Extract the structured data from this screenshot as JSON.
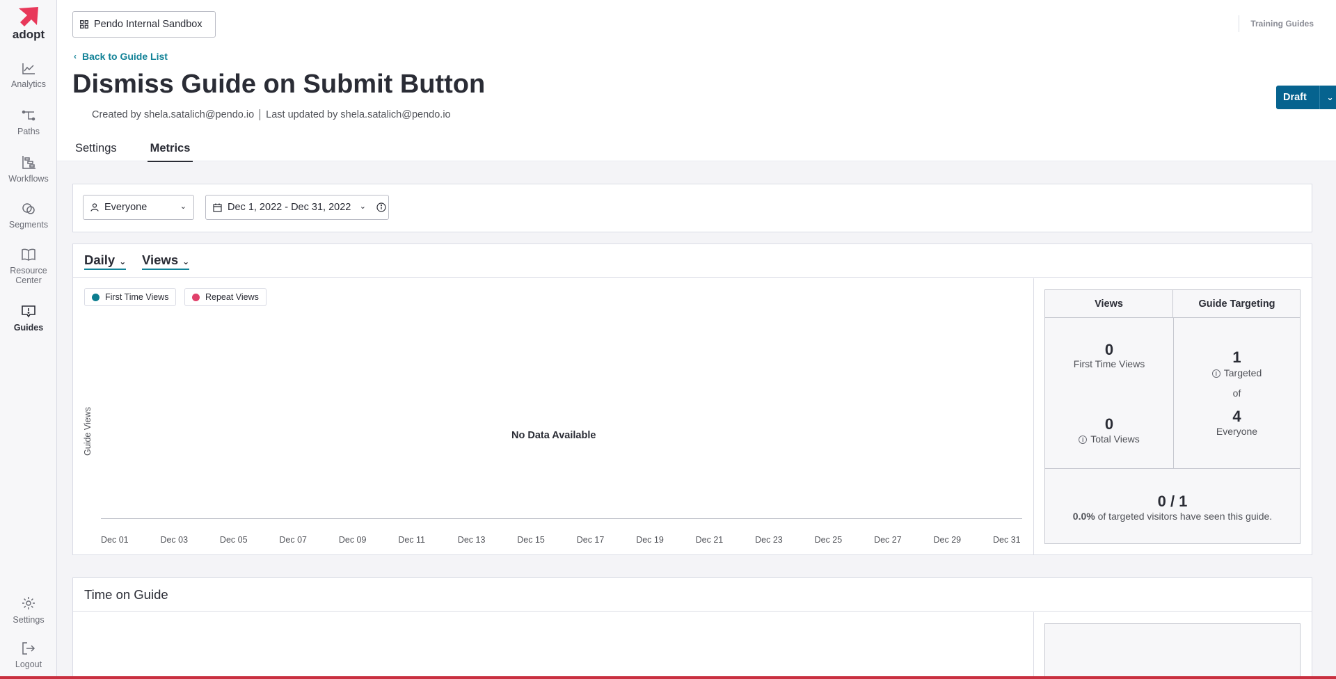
{
  "brand": {
    "name": "adopt",
    "accent": "#e8385a",
    "primary": "#06638f",
    "link": "#128297"
  },
  "sidebar": {
    "items": [
      {
        "label": "Analytics",
        "icon": "chart-line-icon"
      },
      {
        "label": "Paths",
        "icon": "paths-icon"
      },
      {
        "label": "Workflows",
        "icon": "workflows-icon"
      },
      {
        "label": "Segments",
        "icon": "segments-icon"
      },
      {
        "label": "Resource Center",
        "icon": "book-icon"
      },
      {
        "label": "Guides",
        "icon": "guides-icon"
      }
    ],
    "bottom": [
      {
        "label": "Settings",
        "icon": "gear-icon"
      },
      {
        "label": "Logout",
        "icon": "logout-icon"
      }
    ]
  },
  "header": {
    "app_selector": "Pendo Internal Sandbox",
    "training_guides": "Training Guides",
    "back_link": "Back to Guide List",
    "title": "Dismiss Guide on Submit Button",
    "created_by": "Created by shela.satalich@pendo.io",
    "updated_by": "Last updated by shela.satalich@pendo.io",
    "status_button": "Draft",
    "more": "···"
  },
  "tabs": [
    {
      "label": "Settings",
      "active": false
    },
    {
      "label": "Metrics",
      "active": true
    }
  ],
  "filters": {
    "segment": "Everyone",
    "date_range": "Dec 1, 2022 - Dec 31, 2022"
  },
  "chart": {
    "interval": "Daily",
    "metric": "Views",
    "legend": [
      {
        "name": "First Time Views",
        "color": "#0c7d8f"
      },
      {
        "name": "Repeat Views",
        "color": "#e0406a"
      }
    ],
    "ylabel": "Guide Views",
    "empty_message": "No Data Available",
    "ticks": [
      "Dec 01",
      "Dec 03",
      "Dec 05",
      "Dec 07",
      "Dec 09",
      "Dec 11",
      "Dec 13",
      "Dec 15",
      "Dec 17",
      "Dec 19",
      "Dec 21",
      "Dec 23",
      "Dec 25",
      "Dec 27",
      "Dec 29",
      "Dec 31"
    ]
  },
  "chart_data": {
    "type": "bar",
    "categories": [
      "Dec 01",
      "Dec 03",
      "Dec 05",
      "Dec 07",
      "Dec 09",
      "Dec 11",
      "Dec 13",
      "Dec 15",
      "Dec 17",
      "Dec 19",
      "Dec 21",
      "Dec 23",
      "Dec 25",
      "Dec 27",
      "Dec 29",
      "Dec 31"
    ],
    "series": [
      {
        "name": "First Time Views",
        "values": []
      },
      {
        "name": "Repeat Views",
        "values": []
      }
    ],
    "title": "",
    "xlabel": "",
    "ylabel": "Guide Views",
    "annotation": "No Data Available",
    "legend_position": "top-left"
  },
  "stats": {
    "views_header": "Views",
    "targeting_header": "Guide Targeting",
    "first_time_views": {
      "value": "0",
      "label": "First Time Views"
    },
    "total_views": {
      "value": "0",
      "label": "Total Views"
    },
    "targeted": {
      "value": "1",
      "label": "Targeted"
    },
    "of": "of",
    "everyone": {
      "value": "4",
      "label": "Everyone"
    },
    "ratio": "0 / 1",
    "percent": "0.0%",
    "ratio_caption": "of targeted visitors have seen this guide."
  },
  "time_on_guide": {
    "title": "Time on Guide"
  }
}
